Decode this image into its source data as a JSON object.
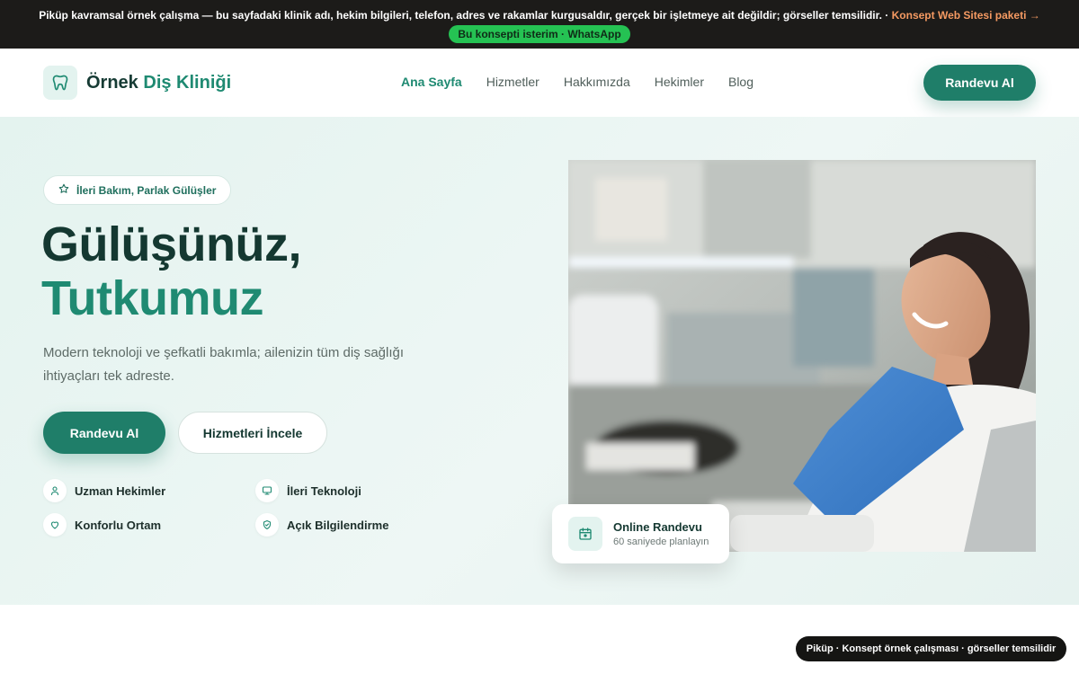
{
  "notice": {
    "bold_lead": "Piküp kavramsal örnek çalışma",
    "text_middle": " — bu sayfadaki klinik adı, hekim bilgileri, telefon, adres ve rakamlar ",
    "bold_word": "kurgusaldır",
    "text_end": ", gerçek bir işletmeye ait değildir; görseller temsilidir. · ",
    "link": "Konsept Web Sitesi paketi →",
    "cta": "Bu konsepti isterim · WhatsApp"
  },
  "header": {
    "logo_word1": "Örnek",
    "logo_word2": "Diş Kliniği",
    "nav": [
      "Ana Sayfa",
      "Hizmetler",
      "Hakkımızda",
      "Hekimler",
      "Blog"
    ],
    "cta": "Randevu Al"
  },
  "hero": {
    "pill": "İleri Bakım, Parlak Gülüşler",
    "title_line1": "Gülüşünüz,",
    "title_line2": "Tutkumuz",
    "lead": "Modern teknoloji ve şefkatli bakımla; ailenizin tüm diş sağlığı ihtiyaçları tek adreste.",
    "primary_button": "Randevu Al",
    "secondary_button": "Hizmetleri İncele",
    "features": [
      "Uzman Hekimler",
      "İleri Teknoloji",
      "Konforlu Ortam",
      "Açık Bilgilendirme"
    ]
  },
  "float_card": {
    "title": "Online Randevu",
    "subtitle": "60 saniyede planlayın"
  },
  "bottom_badge": "Piküp · Konsept örnek çalışması · görseller temsilidir",
  "colors": {
    "brand": "#1f8a72",
    "brand_dark": "#1f7e69",
    "heading": "#143831",
    "notice_bg": "#1c1b19",
    "whatsapp": "#25c253",
    "link": "#f59a62"
  },
  "icons": [
    "tooth-icon",
    "star-icon",
    "doctor-icon",
    "monitor-icon",
    "heart-icon",
    "shield-check-icon",
    "calendar-icon"
  ]
}
